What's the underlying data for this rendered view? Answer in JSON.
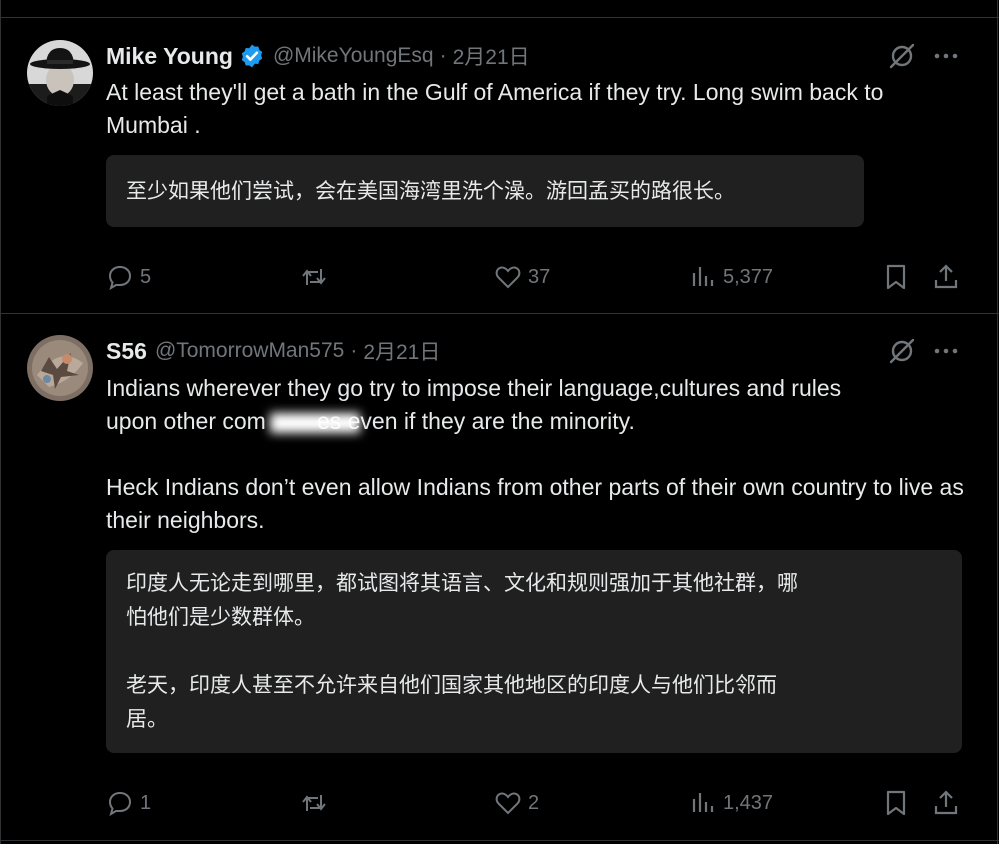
{
  "tweets": [
    {
      "display_name": "Mike Young",
      "handle": "@MikeYoungEsq",
      "separator": "·",
      "date": "2月21日",
      "text": "At least they'll get a bath in the Gulf of America if they try. Long swim back to Mumbai .",
      "translation": "至少如果他们尝试，会在美国海湾里洗个澡。游回孟买的路很长。",
      "actions": {
        "replies": "5",
        "reposts": "",
        "likes": "37",
        "views": "5,377"
      },
      "icons": [
        "verified-badge-icon",
        "grok-icon",
        "more-icon",
        "reply-icon",
        "repost-icon",
        "like-icon",
        "views-icon",
        "bookmark-icon",
        "share-icon"
      ]
    },
    {
      "display_name": "S56",
      "handle": "@TomorrowMan575",
      "separator": "·",
      "date": "2月21日",
      "text_line1": "Indians wherever they go try to impose their language,cultures and rules",
      "text_line2": "upon other com        es even if they are the minority.",
      "text_para2": "Heck Indians don’t even allow Indians from other parts of their own country to live as their neighbors.",
      "translation": "印度人无论走到哪里，都试图将其语言、文化和规则强加于其他社群，哪\n怕他们是少数群体。\n\n老天，印度人甚至不允许来自他们国家其他地区的印度人与他们比邻而\n居。",
      "actions": {
        "replies": "1",
        "reposts": "",
        "likes": "2",
        "views": "1,437"
      },
      "icons": [
        "grok-icon",
        "more-icon",
        "reply-icon",
        "repost-icon",
        "like-icon",
        "views-icon",
        "bookmark-icon",
        "share-icon"
      ]
    }
  ],
  "colors": {
    "background": "#000000",
    "text_primary": "#e7e9ea",
    "text_secondary": "#71767b",
    "verified_blue": "#1d9bf0",
    "translation_bg": "#202020",
    "divider": "#2f3336"
  }
}
